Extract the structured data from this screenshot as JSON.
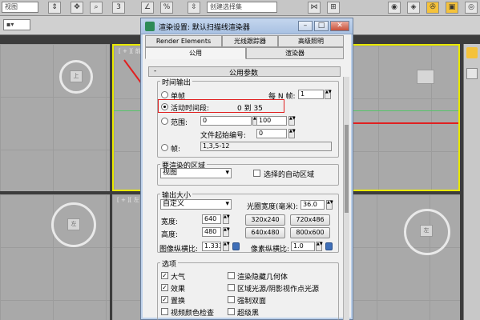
{
  "toolbar": {
    "view_select": "视图",
    "select_set": "创建选择集",
    "icons": [
      "arrow-icon",
      "crosshair-icon",
      "zoom-icon",
      "percent-icon",
      "snap-icon"
    ]
  },
  "viewports": {
    "top_left_label": "上",
    "top_right_caption": "[ + ][ 前",
    "bottom_left_label": "左",
    "bottom_left_caption": "[ + ][ 左",
    "bottom_right_label": "左",
    "gizmo_color": "#e9e9e9"
  },
  "dialog": {
    "title": "渲染设置: 默认扫描线渲染器",
    "tabs_row1": [
      "Render Elements",
      "光线跟踪器",
      "高级照明"
    ],
    "tabs_row2": [
      "公用",
      "渲染器"
    ],
    "rollout_title": "公用参数",
    "time_output": {
      "label": "时间输出",
      "single": "单帧",
      "every_n_label": "每 N 帧:",
      "every_n_value": "1",
      "active_segment": "活动时间段:",
      "active_value": "0 到 35",
      "range": "范围:",
      "range_from": "0",
      "range_to_label": "至",
      "range_to": "100",
      "file_start_label": "文件起始编号:",
      "file_start": "0",
      "frames": "帧:",
      "frames_value": "1,3,5-12"
    },
    "render_area": {
      "label": "要渲染的区域",
      "select": "视图",
      "auto_region": "选择的自动区域"
    },
    "output_size": {
      "label": "输出大小",
      "preset": "自定义",
      "aperture_label": "光圈宽度(毫米):",
      "aperture_value": "36.0",
      "width_label": "宽度:",
      "width_value": "640",
      "height_label": "高度:",
      "height_value": "480",
      "presets": [
        "320x240",
        "720x486",
        "640x480",
        "800x600"
      ],
      "image_aspect_label": "图像纵横比:",
      "image_aspect_value": "1.333",
      "pixel_aspect_label": "像素纵横比:",
      "pixel_aspect_value": "1.0"
    },
    "options": {
      "label": "选项",
      "items": [
        {
          "label": "大气",
          "checked": true
        },
        {
          "label": "渲染隐藏几何体",
          "checked": false
        },
        {
          "label": "效果",
          "checked": true
        },
        {
          "label": "区域光源/阴影视作点光源",
          "checked": false
        },
        {
          "label": "置换",
          "checked": true
        },
        {
          "label": "强制双面",
          "checked": false
        },
        {
          "label": "视频颜色检查",
          "checked": false
        },
        {
          "label": "超级黑",
          "checked": false
        }
      ]
    }
  },
  "colors": {
    "highlight_red": "#e02020",
    "viewport_gray": "#a9a9a9",
    "active_viewport_border": "#e8e800"
  }
}
